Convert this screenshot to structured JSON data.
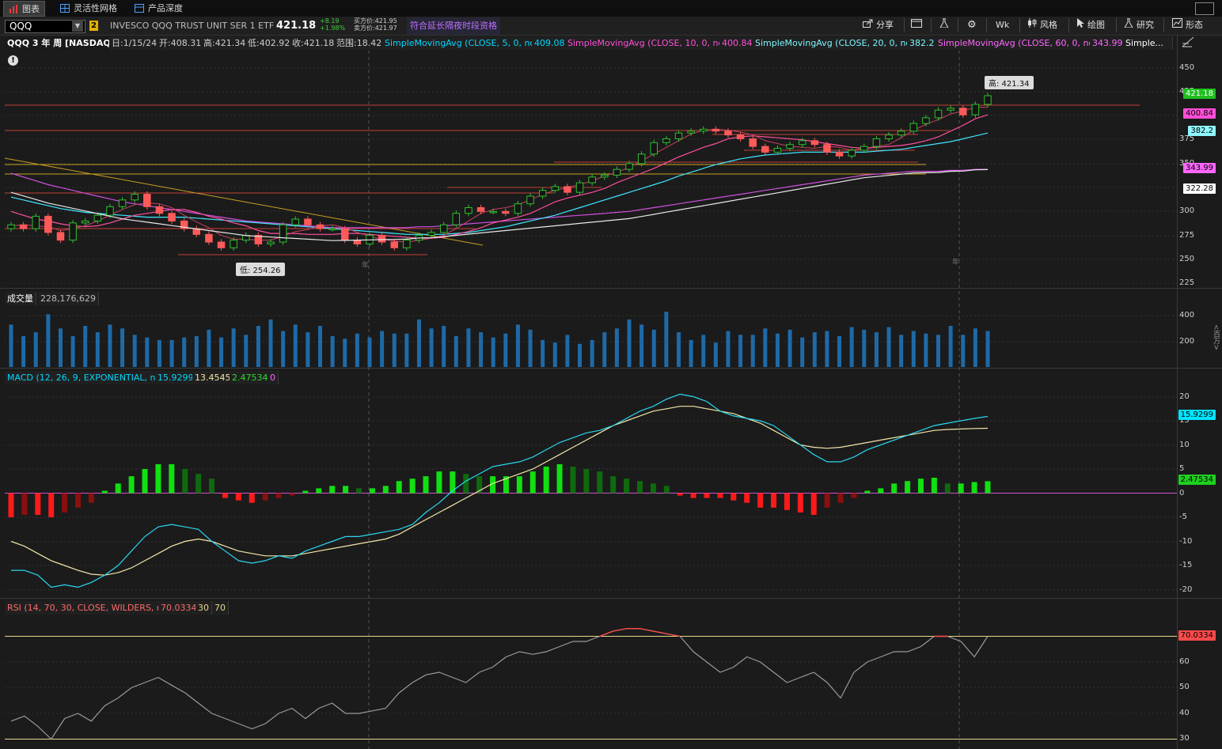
{
  "tabs": [
    {
      "label": "图表",
      "active": true
    },
    {
      "label": "灵活性网格",
      "active": false
    },
    {
      "label": "产品深度",
      "active": false
    }
  ],
  "toolbar": {
    "symbol": "QQQ",
    "link_badge": "2",
    "description": "INVESCO QQQ TRUST UNIT SER 1 ETF",
    "last_price": "421.18",
    "change": "+8.19",
    "change_pct": "+1.98%",
    "bid": "买方价:421.95",
    "ask": "卖方价:421.97",
    "extended_label": "符合延长隔夜时段资格",
    "share_label": "分享",
    "period_label": "Wk",
    "style_label": "风格",
    "draw_label": "绘图",
    "studies_label": "研究",
    "patterns_label": "形态"
  },
  "header": {
    "title": "QQQ 3 年 周 [NASDAQ]",
    "date": "日:1/15/24",
    "open": "开:408.31",
    "high": "高:421.34",
    "low": "低:402.92",
    "close": "收:421.18",
    "range": "范围:18.42",
    "studies": [
      {
        "label": "SimpleMovingAvg (CLOSE, 5, 0, no)",
        "value": "409.08",
        "color": "#00d8ff"
      },
      {
        "label": "SimpleMovingAvg (CLOSE, 10, 0, no)",
        "value": "400.84",
        "color": "#ff4fd8"
      },
      {
        "label": "SimpleMovingAvg (CLOSE, 20, 0, no)",
        "value": "382.2",
        "color": "#7cf5ff"
      },
      {
        "label": "SimpleMovingAvg (CLOSE, 60, 0, no)",
        "value": "343.99",
        "color": "#ff66ff"
      },
      {
        "label": "Simple...",
        "value": "",
        "color": "#ffffff"
      }
    ]
  },
  "price_pane": {
    "price_axis": [
      "450",
      "425",
      "375",
      "350",
      "300",
      "275",
      "250",
      "225"
    ],
    "tags": [
      {
        "value": "421.18",
        "bg": "#1fbf1f",
        "fg": "#ffffff"
      },
      {
        "value": "400.84",
        "bg": "#ff4fd8",
        "fg": "#000000"
      },
      {
        "value": "382.2",
        "bg": "#8ff6ff",
        "fg": "#000000"
      },
      {
        "value": "343.99",
        "bg": "#ff66ff",
        "fg": "#000000"
      },
      {
        "value": "322.28",
        "bg": "#ffffff",
        "fg": "#000000"
      }
    ],
    "high_callout": "高: 421.34",
    "low_callout": "低: 254.26",
    "year_markers": [
      "年",
      "年"
    ]
  },
  "volume_pane": {
    "label": "成交量",
    "value": "228,176,629",
    "axis": [
      "400",
      "200"
    ],
    "unit": "<百万>"
  },
  "macd_pane": {
    "label": "MACD (12, 26, 9, EXPONENTIAL, no)",
    "value1": "15.9299",
    "value2": "13.4545",
    "value3": "2.47534",
    "value4": "0",
    "axis": [
      "20",
      "15",
      "10",
      "5",
      "0",
      "-5",
      "-10",
      "-15",
      "-20"
    ],
    "tags": [
      {
        "value": "15.9299",
        "bg": "#00e5ff",
        "fg": "#000000"
      },
      {
        "value": "2.47534",
        "bg": "#1fd01f",
        "fg": "#000000"
      }
    ]
  },
  "rsi_pane": {
    "label": "RSI (14, 70, 30, CLOSE, WILDERS, no)",
    "value": "70.0334",
    "ob": "30",
    "os": "70",
    "axis": [
      "60",
      "50",
      "40",
      "30"
    ],
    "tag": {
      "value": "70.0334",
      "bg": "#ff4a4a",
      "fg": "#000000"
    }
  },
  "chart_data": [
    {
      "type": "candlestick",
      "title": "QQQ 3 年 周 [NASDAQ]",
      "ylim": [
        225,
        455
      ],
      "series": [
        {
          "name": "close",
          "values": [
            286,
            282,
            295,
            278,
            270,
            288,
            290,
            296,
            305,
            312,
            318,
            305,
            298,
            290,
            282,
            276,
            268,
            262,
            270,
            275,
            266,
            268,
            286,
            292,
            286,
            282,
            282,
            270,
            266,
            275,
            268,
            262,
            270,
            275,
            278,
            286,
            298,
            304,
            300,
            300,
            298,
            308,
            316,
            322,
            326,
            320,
            330,
            336,
            338,
            344,
            350,
            360,
            372,
            376,
            382,
            384,
            386,
            384,
            380,
            376,
            368,
            362,
            366,
            370,
            374,
            370,
            362,
            358,
            364,
            368,
            376,
            380,
            384,
            392,
            398,
            406,
            408,
            401,
            412,
            421
          ]
        },
        {
          "name": "SimpleMovingAvg (CLOSE, 5, 0, no)",
          "values": [
            285,
            286,
            285,
            284,
            280,
            282,
            285,
            290,
            296,
            302,
            307,
            309,
            308,
            304,
            296,
            289,
            283,
            275,
            271,
            271,
            270,
            270,
            274,
            279,
            281,
            285,
            286,
            283,
            278,
            274,
            271,
            269,
            268,
            270,
            272,
            275,
            282,
            290,
            298,
            302,
            304,
            307,
            312,
            318,
            322,
            325,
            328,
            332,
            337,
            341,
            346,
            353,
            360,
            367,
            374,
            381,
            385,
            386,
            385,
            383,
            380,
            374,
            371,
            368,
            367,
            366,
            368,
            367,
            364,
            366,
            368,
            370,
            377,
            385,
            391,
            396,
            402,
            405,
            409,
            409
          ]
        },
        {
          "name": "SimpleMovingAvg (CLOSE, 10, 0, no)",
          "values": [
            300,
            296,
            292,
            290,
            287,
            285,
            284,
            285,
            288,
            292,
            296,
            298,
            300,
            302,
            302,
            299,
            295,
            292,
            288,
            285,
            280,
            277,
            277,
            277,
            276,
            276,
            276,
            277,
            277,
            276,
            275,
            274,
            273,
            272,
            272,
            273,
            276,
            279,
            283,
            288,
            291,
            294,
            298,
            304,
            310,
            314,
            317,
            320,
            324,
            330,
            335,
            340,
            345,
            351,
            357,
            362,
            367,
            371,
            376,
            378,
            379,
            378,
            377,
            376,
            375,
            373,
            371,
            369,
            367,
            366,
            367,
            368,
            369,
            371,
            374,
            378,
            384,
            390,
            397,
            401
          ]
        },
        {
          "name": "SimpleMovingAvg (CLOSE, 20, 0, no)",
          "values": [
            315,
            312,
            309,
            306,
            303,
            301,
            299,
            298,
            297,
            296,
            295,
            294,
            294,
            294,
            294,
            293,
            292,
            291,
            290,
            289,
            288,
            287,
            286,
            285,
            284,
            283,
            282,
            281,
            280,
            279,
            278,
            277,
            276,
            276,
            276,
            276,
            277,
            278,
            280,
            282,
            284,
            287,
            290,
            293,
            296,
            300,
            304,
            308,
            312,
            316,
            320,
            324,
            328,
            332,
            337,
            341,
            345,
            349,
            352,
            355,
            357,
            359,
            360,
            361,
            362,
            362,
            362,
            362,
            362,
            362,
            363,
            364,
            365,
            367,
            369,
            371,
            373,
            376,
            379,
            382
          ]
        },
        {
          "name": "SimpleMovingAvg (CLOSE, 60, 0, no)",
          "values": [
            340,
            336,
            332,
            328,
            325,
            322,
            319,
            316,
            313,
            310,
            308,
            306,
            304,
            302,
            300,
            298,
            296,
            294,
            292,
            290,
            289,
            288,
            287,
            286,
            285,
            284,
            283,
            283,
            283,
            283,
            283,
            283,
            283,
            284,
            284,
            285,
            286,
            287,
            288,
            289,
            290,
            291,
            292,
            293,
            294,
            295,
            296,
            297,
            298,
            299,
            300,
            302,
            304,
            306,
            308,
            310,
            312,
            314,
            316,
            318,
            320,
            322,
            324,
            326,
            328,
            330,
            332,
            334,
            336,
            338,
            339,
            340,
            341,
            342,
            342,
            342,
            343,
            343,
            344,
            344
          ]
        }
      ]
    },
    {
      "type": "bar",
      "title": "成交量",
      "ylim": [
        0,
        450
      ],
      "series": [
        {
          "name": "volume",
          "values": [
            330,
            240,
            270,
            410,
            300,
            240,
            320,
            270,
            330,
            300,
            250,
            230,
            210,
            210,
            230,
            240,
            290,
            230,
            300,
            250,
            320,
            370,
            280,
            330,
            270,
            320,
            240,
            220,
            260,
            230,
            280,
            260,
            260,
            370,
            300,
            320,
            240,
            300,
            270,
            230,
            260,
            330,
            290,
            210,
            190,
            250,
            180,
            210,
            270,
            300,
            370,
            330,
            290,
            430,
            270,
            210,
            250,
            190,
            280,
            250,
            250,
            300,
            260,
            290,
            230,
            270,
            280,
            240,
            310,
            290,
            270,
            310,
            250,
            280,
            260,
            250,
            320,
            250,
            300,
            280
          ]
        }
      ]
    },
    {
      "type": "line",
      "title": "MACD (12, 26, 9, EXPONENTIAL, no)",
      "ylim": [
        -21,
        21
      ],
      "series": [
        {
          "name": "value",
          "values": [
            -16,
            -16,
            -17,
            -19.5,
            -19,
            -19.5,
            -18.5,
            -17,
            -15,
            -12,
            -9,
            -7,
            -6.5,
            -7,
            -7.5,
            -10,
            -12,
            -14,
            -14.5,
            -14,
            -13,
            -13.5,
            -12,
            -11,
            -10,
            -9,
            -9,
            -8.5,
            -8,
            -7.5,
            -6.5,
            -4,
            -2,
            0.5,
            2.5,
            4,
            5.5,
            6,
            6.5,
            7.5,
            9,
            10.5,
            11.5,
            12.5,
            13,
            14,
            15.5,
            17,
            18,
            19.5,
            20.5,
            20,
            19,
            17,
            16,
            15.5,
            15,
            14,
            12,
            10,
            8,
            6.5,
            6.5,
            7.5,
            9,
            10,
            11,
            12,
            13,
            14,
            14.5,
            15,
            15.5,
            15.9
          ]
        },
        {
          "name": "avg",
          "values": [
            -10,
            -11,
            -12.5,
            -14,
            -15,
            -16,
            -16.8,
            -17,
            -16.5,
            -15.5,
            -14,
            -12.5,
            -11,
            -10,
            -9.5,
            -10,
            -11,
            -12,
            -12.5,
            -13,
            -13,
            -13,
            -12.5,
            -12,
            -11.5,
            -11,
            -10.5,
            -10,
            -9.5,
            -8.5,
            -7,
            -5.5,
            -4,
            -2.5,
            -1,
            0.5,
            2,
            3,
            4,
            5,
            6.5,
            8,
            9.5,
            11,
            12.5,
            14,
            15,
            16,
            17,
            17.5,
            18,
            18,
            17.5,
            17,
            16.5,
            15.5,
            14.5,
            13,
            11.5,
            10,
            9.5,
            9.3,
            9.5,
            10,
            10.5,
            11,
            11.5,
            12,
            12.5,
            13,
            13.2,
            13.3,
            13.4,
            13.45
          ]
        },
        {
          "name": "diff",
          "values": [
            -5,
            -4.5,
            -4.5,
            -5,
            -4,
            -3,
            -2,
            0.5,
            2,
            3.5,
            5,
            6,
            6,
            5,
            4,
            3,
            -1,
            -1.5,
            -2,
            -1.5,
            -1,
            -0.5,
            0.5,
            1,
            1.5,
            1.5,
            1,
            1,
            1.5,
            2.5,
            3,
            3.5,
            4.5,
            4.5,
            4,
            3.5,
            3.5,
            3.5,
            3.5,
            4.5,
            5.5,
            6,
            5.5,
            5,
            4.5,
            3.5,
            3,
            2.5,
            2,
            1.5,
            -0.5,
            -1,
            -1,
            -1,
            -1.5,
            -2,
            -3,
            -3,
            -3.5,
            -4,
            -4.5,
            -3,
            -2,
            -1,
            0.5,
            1,
            2,
            2.5,
            3,
            3.2,
            2,
            2,
            2.3,
            2.48
          ]
        }
      ]
    },
    {
      "type": "line",
      "title": "RSI (14, 70, 30, CLOSE, WILDERS, no)",
      "ylim": [
        29,
        76
      ],
      "series": [
        {
          "name": "RSI",
          "values": [
            37,
            39,
            35,
            30,
            38,
            40,
            37,
            43,
            46,
            50,
            52,
            54,
            51,
            48,
            44,
            40,
            38,
            36,
            34,
            36,
            40,
            42,
            38,
            42,
            44,
            40,
            40,
            41,
            42,
            48,
            52,
            55,
            56,
            54,
            52,
            56,
            58,
            62,
            64,
            63,
            64,
            66,
            68,
            68,
            70,
            72,
            73,
            73,
            72,
            71,
            70,
            64,
            60,
            56,
            58,
            62,
            60,
            56,
            52,
            54,
            56,
            52,
            46,
            56,
            60,
            62,
            64,
            64,
            66,
            70,
            70,
            68,
            62,
            70
          ]
        }
      ]
    }
  ]
}
